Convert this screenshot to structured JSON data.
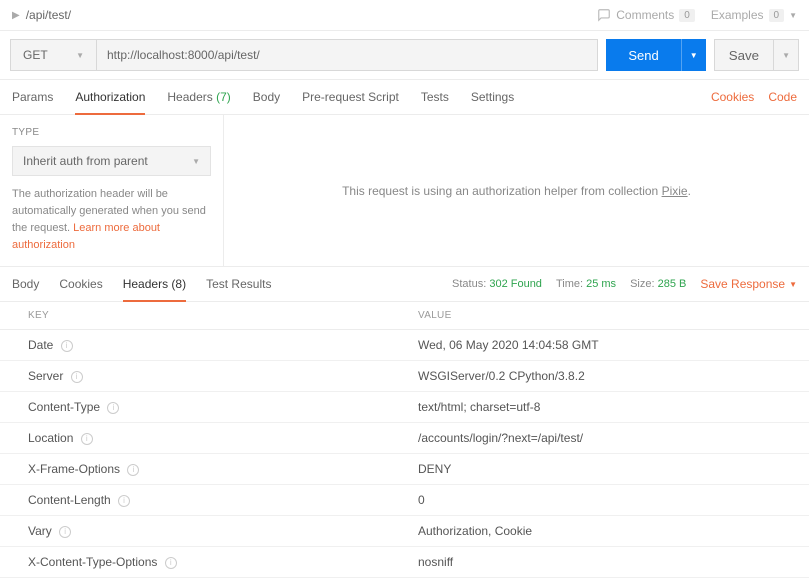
{
  "breadcrumb": "/api/test/",
  "top": {
    "comments": "Comments",
    "comments_count": "0",
    "examples": "Examples",
    "examples_count": "0"
  },
  "request": {
    "method": "GET",
    "url": "http://localhost:8000/api/test/",
    "send": "Send",
    "save": "Save"
  },
  "req_tabs": [
    "Params",
    "Authorization",
    "Headers",
    "Body",
    "Pre-request Script",
    "Tests",
    "Settings"
  ],
  "headers_count": "(7)",
  "cookies_link": "Cookies",
  "code_link": "Code",
  "auth": {
    "type_label": "TYPE",
    "selected": "Inherit auth from parent",
    "desc1": "The authorization header will be automatically generated when you send the request. ",
    "learn": "Learn more about authorization",
    "helper_pre": "This request is using an authorization helper from collection ",
    "helper_name": "Pixie"
  },
  "resp_tabs": [
    "Body",
    "Cookies",
    "Headers",
    "Test Results"
  ],
  "resp_headers_count": "(8)",
  "meta": {
    "status_lbl": "Status:",
    "status": "302 Found",
    "time_lbl": "Time:",
    "time": "25 ms",
    "size_lbl": "Size:",
    "size": "285 B",
    "save": "Save Response"
  },
  "table": {
    "hkey": "KEY",
    "hval": "VALUE",
    "rows": [
      {
        "k": "Date",
        "v": "Wed, 06 May 2020 14:04:58 GMT"
      },
      {
        "k": "Server",
        "v": "WSGIServer/0.2 CPython/3.8.2"
      },
      {
        "k": "Content-Type",
        "v": "text/html; charset=utf-8"
      },
      {
        "k": "Location",
        "v": "/accounts/login/?next=/api/test/"
      },
      {
        "k": "X-Frame-Options",
        "v": "DENY"
      },
      {
        "k": "Content-Length",
        "v": "0"
      },
      {
        "k": "Vary",
        "v": "Authorization, Cookie"
      },
      {
        "k": "X-Content-Type-Options",
        "v": "nosniff"
      }
    ]
  }
}
